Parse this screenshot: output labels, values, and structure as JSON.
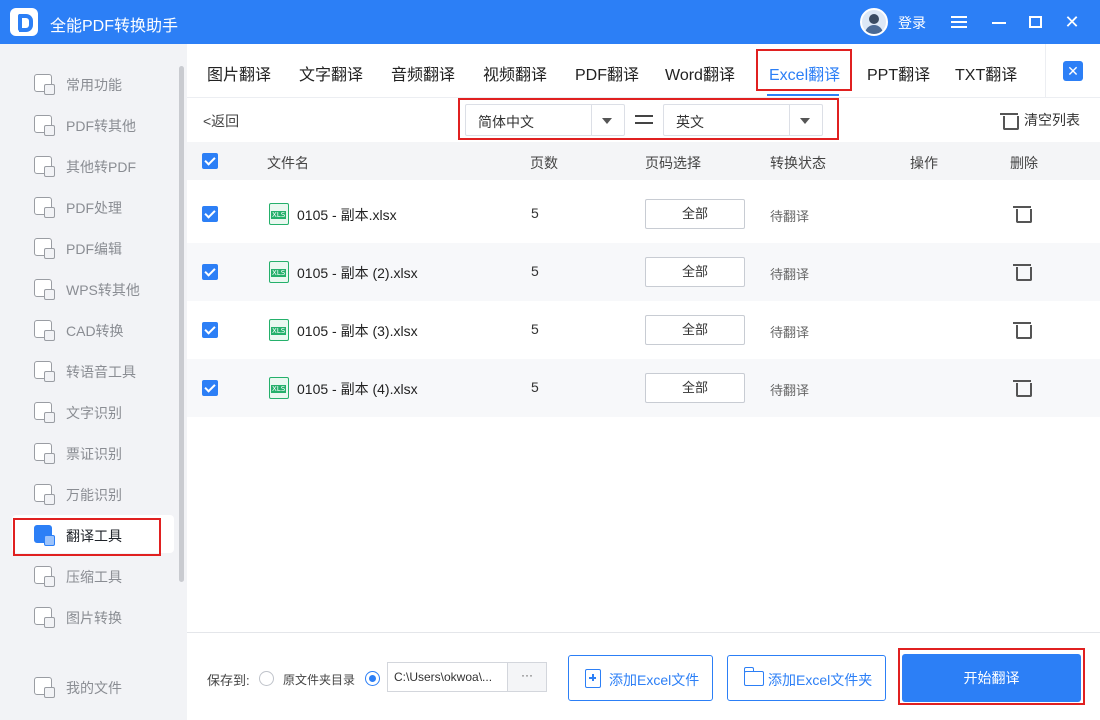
{
  "window": {
    "title": "全能PDF转换助手",
    "login_label": "登录",
    "close_glyph": "✕",
    "accent_color": "#2c7ff6",
    "highlight_color": "#e02020"
  },
  "sidebar": {
    "items": [
      {
        "label": "常用功能",
        "icon": "star-grid-icon"
      },
      {
        "label": "PDF转其他",
        "icon": "pdf-convert-icon"
      },
      {
        "label": "其他转PDF",
        "icon": "to-pdf-icon"
      },
      {
        "label": "PDF处理",
        "icon": "pdf-process-icon"
      },
      {
        "label": "PDF编辑",
        "icon": "pdf-edit-icon"
      },
      {
        "label": "WPS转其他",
        "icon": "wps-convert-icon"
      },
      {
        "label": "CAD转换",
        "icon": "cad-convert-icon"
      },
      {
        "label": "转语音工具",
        "icon": "voice-tool-icon"
      },
      {
        "label": "文字识别",
        "icon": "text-ocr-icon"
      },
      {
        "label": "票证识别",
        "icon": "ticket-ocr-icon"
      },
      {
        "label": "万能识别",
        "icon": "universal-ocr-icon"
      },
      {
        "label": "翻译工具",
        "icon": "translate-tool-icon",
        "active": true
      },
      {
        "label": "压缩工具",
        "icon": "compress-tool-icon"
      },
      {
        "label": "图片转换",
        "icon": "image-convert-icon"
      }
    ],
    "my_files": "我的文件"
  },
  "tabs": [
    "图片翻译",
    "文字翻译",
    "音频翻译",
    "视频翻译",
    "PDF翻译",
    "Word翻译",
    "Excel翻译",
    "PPT翻译",
    "TXT翻译"
  ],
  "active_tab": "Excel翻译",
  "panel_close_glyph": "✕",
  "toolbar": {
    "back_label": "<返回",
    "source_lang": "简体中文",
    "target_lang": "英文",
    "clear_list": "清空列表"
  },
  "table": {
    "headers": {
      "filename": "文件名",
      "pages": "页数",
      "range": "页码选择",
      "status": "转换状态",
      "action": "操作",
      "delete": "删除"
    },
    "rows": [
      {
        "filename": "0105 - 副本.xlsx",
        "pages": "5",
        "range": "全部",
        "status": "待翻译",
        "checked": true
      },
      {
        "filename": "0105 - 副本 (2).xlsx",
        "pages": "5",
        "range": "全部",
        "status": "待翻译",
        "checked": true
      },
      {
        "filename": "0105 - 副本 (3).xlsx",
        "pages": "5",
        "range": "全部",
        "status": "待翻译",
        "checked": true
      },
      {
        "filename": "0105 - 副本 (4).xlsx",
        "pages": "5",
        "range": "全部",
        "status": "待翻译",
        "checked": true
      }
    ]
  },
  "bottom": {
    "save_to": "保存到:",
    "option_original": "原文件夹目录",
    "selected_option": "custom-path",
    "path_value": "C:\\Users\\okwoa\\...",
    "path_more": "···",
    "add_file": "添加Excel文件",
    "add_folder": "添加Excel文件夹",
    "start": "开始翻译"
  }
}
